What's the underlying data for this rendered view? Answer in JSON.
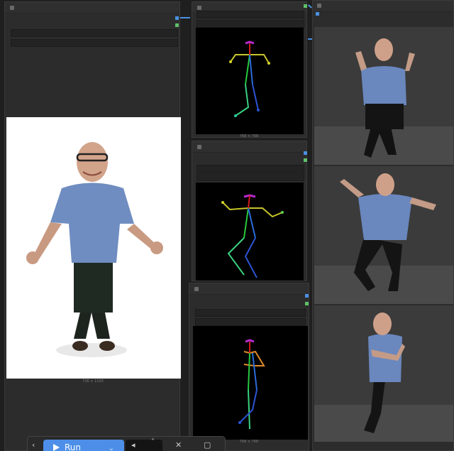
{
  "nodes": {
    "load_image": {
      "size_caption": "736 × 1103"
    },
    "pose_top": {
      "size_caption": "768 × 768"
    },
    "pose_bottom": {
      "size_caption": "768 × 768"
    }
  },
  "toolbar": {
    "expand_icon": "chevron-left-icon",
    "run_label": "Run",
    "run_icon": "play-icon",
    "run_caret": "chevron-down-icon",
    "queue_icon": "step-icon",
    "up_icon": "chevron-up-icon",
    "cancel_icon": "close-icon",
    "stop_icon": "stop-icon"
  },
  "colors": {
    "canvas": "#1f1f1f",
    "node": "#2c2c2c",
    "accent": "#4d8fe8",
    "link": "#4a90e2",
    "port_green": "#5fbf6a"
  }
}
